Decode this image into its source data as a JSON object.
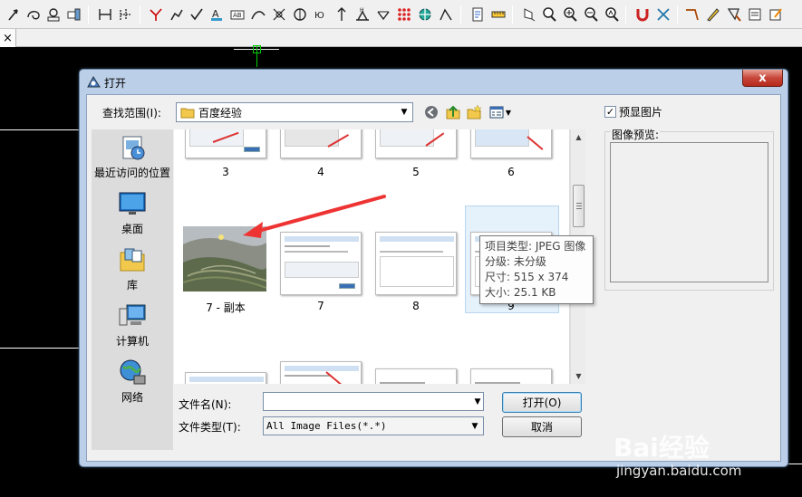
{
  "dialog": {
    "title": "打开",
    "close_label": "x",
    "lookin_label": "查找范围(I):",
    "lookin_value": "百度经验",
    "places": [
      {
        "label": "最近访问的位置",
        "icon": "recent-places-icon"
      },
      {
        "label": "桌面",
        "icon": "desktop-icon"
      },
      {
        "label": "库",
        "icon": "libraries-icon"
      },
      {
        "label": "计算机",
        "icon": "computer-icon"
      },
      {
        "label": "网络",
        "icon": "network-icon"
      }
    ],
    "files": [
      {
        "label": "3"
      },
      {
        "label": "4"
      },
      {
        "label": "5"
      },
      {
        "label": "6"
      },
      {
        "label": "7 - 副本"
      },
      {
        "label": "7"
      },
      {
        "label": "8"
      },
      {
        "label": "9"
      }
    ],
    "tooltip": {
      "line1": "项目类型: JPEG 图像",
      "line2": "分级: 未分级",
      "line3": "尺寸: 515 x 374",
      "line4": "大小: 25.1 KB"
    },
    "filename_label": "文件名(N):",
    "filename_value": "",
    "filetype_label": "文件类型(T):",
    "filetype_value": "All Image Files(*.*)",
    "open_label": "打开(O)",
    "cancel_label": "取消",
    "preview_check_label": "预显图片",
    "preview_checked": true,
    "preview_group_label": "图像预览:"
  },
  "tab": {
    "close_label": "×"
  },
  "watermark": {
    "brand": "Bai经验",
    "url": "jingyan.baidu.com"
  },
  "colors": {
    "titlebar": "#bccfe8",
    "close": "#c7473a",
    "canvas": "#000000"
  }
}
